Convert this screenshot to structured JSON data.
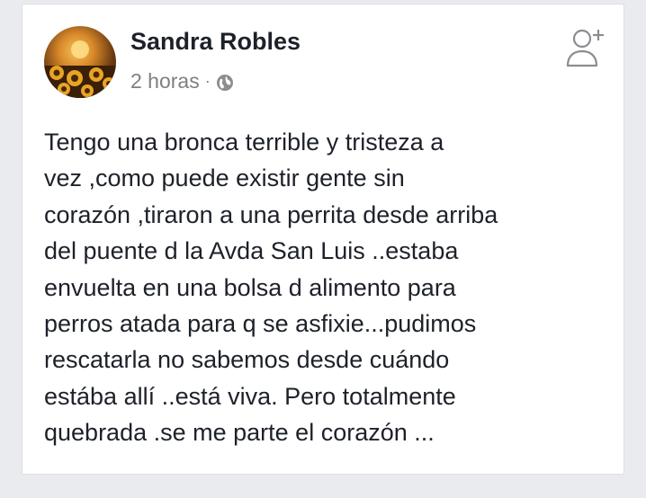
{
  "post": {
    "author_name": "Sandra Robles",
    "timestamp": "2 horas",
    "separator": "·",
    "privacy_icon": "globe-icon",
    "action_icon": "add-friend-icon",
    "text": "Tengo una bronca terrible y tristeza a\nvez ,como puede existir gente sin\ncorazón ,tiraron a una perrita desde arriba\ndel puente d la Avda San Luis ..estaba\nenvuelta en una bolsa d alimento para\nperros atada para q se asfixie...pudimos\nrescatarla no sabemos desde cuándo\nestába allí ..está viva.  Pero totalmente\nquebrada .se me parte el corazón ..."
  },
  "colors": {
    "background": "#e9ebee",
    "card": "#ffffff",
    "text": "#1d2129",
    "meta": "#7f7f7f"
  }
}
